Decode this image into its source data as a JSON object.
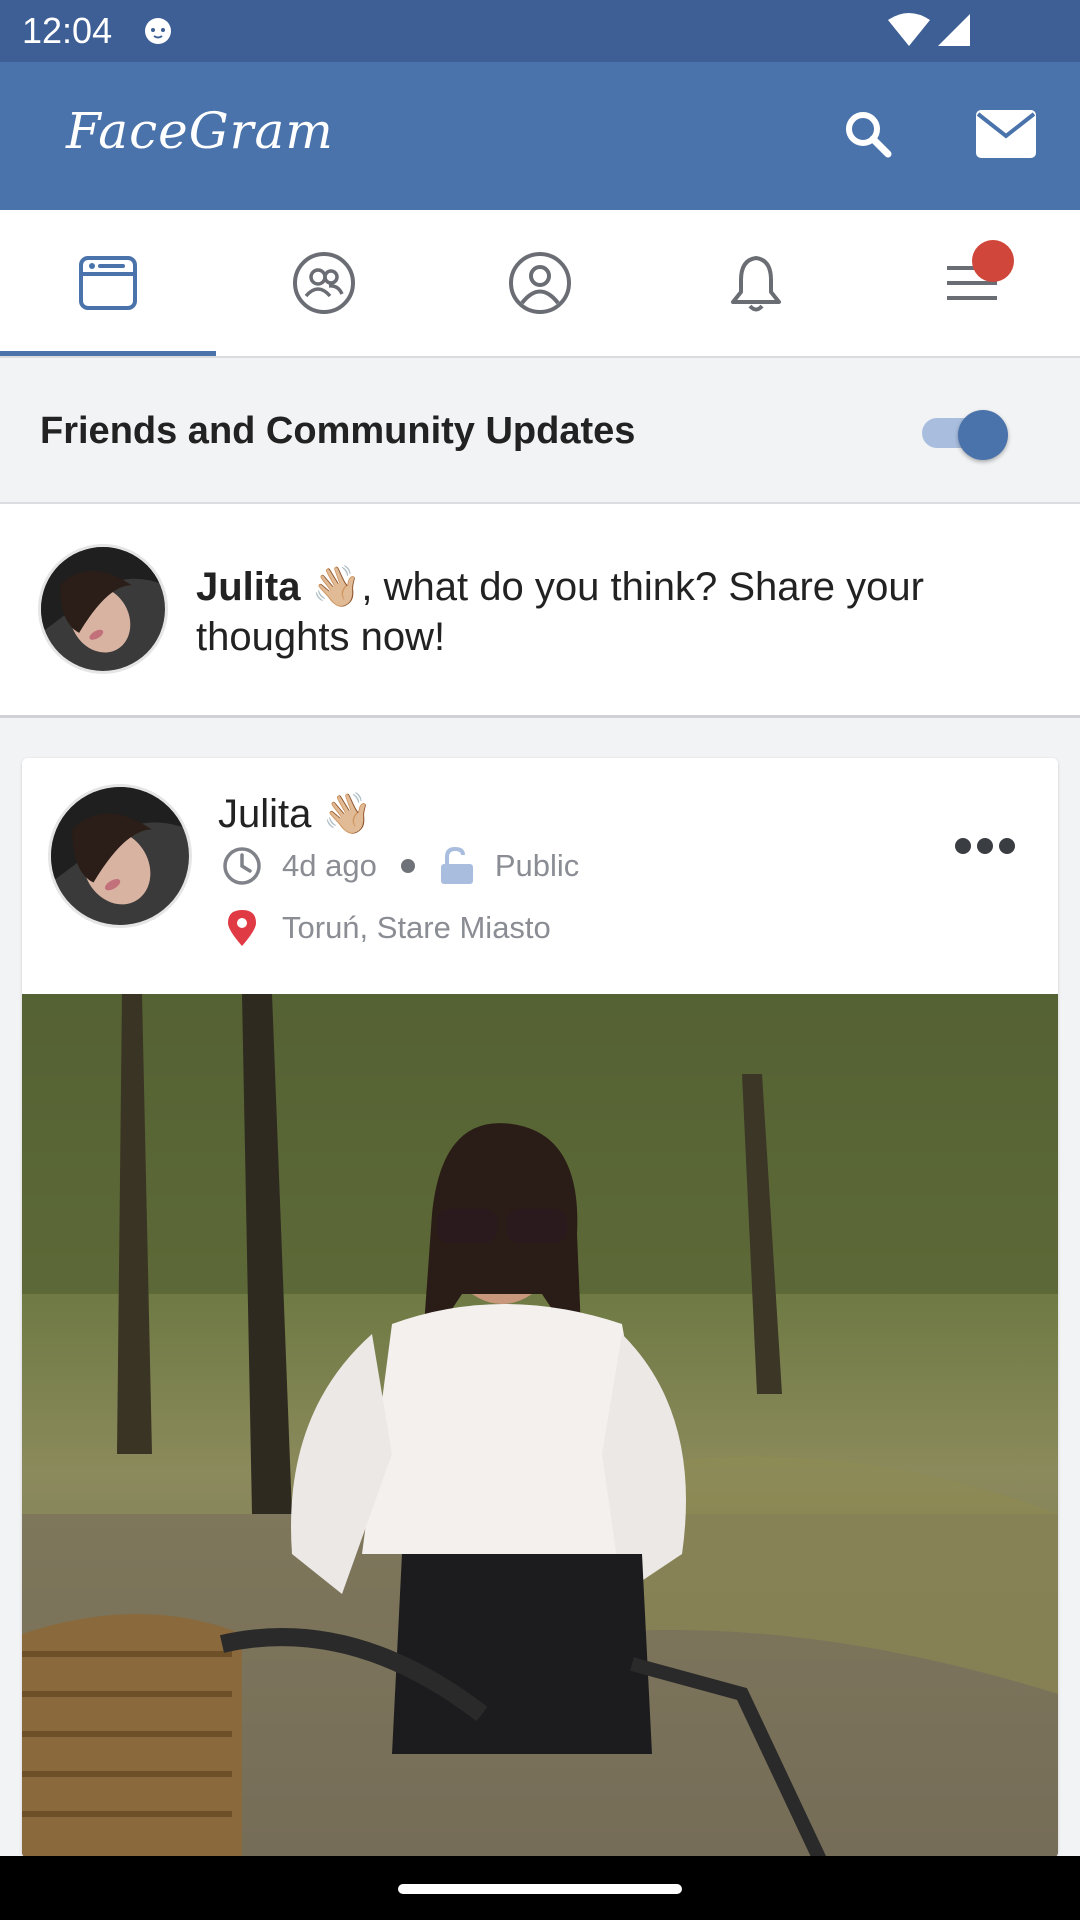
{
  "status_bar": {
    "time": "12:04"
  },
  "app_bar": {
    "title": "FaceGram",
    "search_icon": "search-icon",
    "mail_icon": "mail-icon"
  },
  "tabs": [
    {
      "name": "feed",
      "icon": "newsfeed-icon",
      "active": true
    },
    {
      "name": "friends",
      "icon": "friends-icon",
      "active": false
    },
    {
      "name": "profile",
      "icon": "profile-icon",
      "active": false
    },
    {
      "name": "notifications",
      "icon": "bell-icon",
      "active": false
    },
    {
      "name": "menu",
      "icon": "menu-icon",
      "active": false,
      "badge": true
    }
  ],
  "filter": {
    "label": "Friends and Community Updates",
    "enabled": true
  },
  "composer": {
    "user": "Julita",
    "emoji": "👋🏼",
    "prompt": ", what do you think? Share your thoughts now!"
  },
  "post": {
    "author": "Julita",
    "emoji": "👋🏼",
    "time_ago": "4d ago",
    "visibility": "Public",
    "location": "Toruń, Stare Miasto"
  },
  "colors": {
    "primary": "#4a73ab",
    "status_bar": "#3e5f95",
    "badge": "#d0463a",
    "location_pin": "#e03a45"
  }
}
